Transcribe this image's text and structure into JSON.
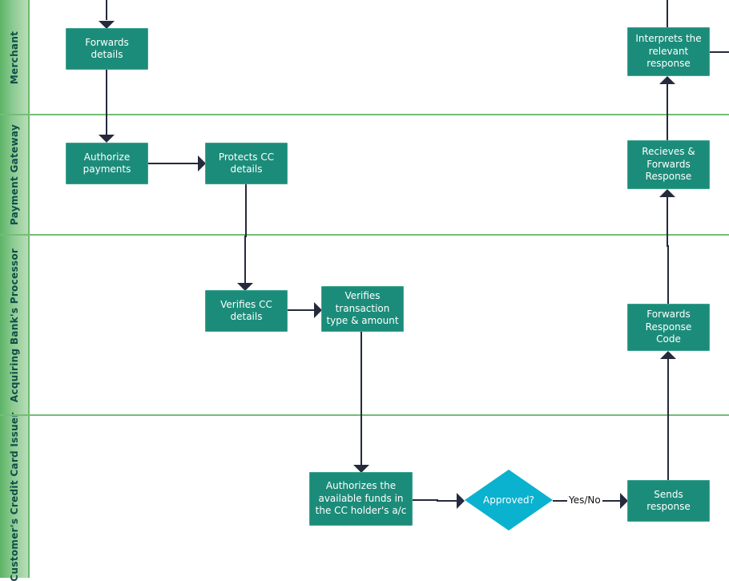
{
  "diagram": {
    "type": "swimlane-flowchart",
    "colors": {
      "process_fill": "#1c8c7a",
      "decision_fill": "#0ab2cf",
      "connector": "#252a3d",
      "lane_border": "#74bd76",
      "lane_label": "#0f4f46"
    },
    "lanes": [
      {
        "id": "merchant",
        "label": "Merchant"
      },
      {
        "id": "gateway",
        "label": "Payment Gateway"
      },
      {
        "id": "acquirer",
        "label": "Acquiring Bank's Processor"
      },
      {
        "id": "issuer",
        "label": "Customer's Credit Card Issuer"
      }
    ],
    "nodes": {
      "forwards_details": {
        "label": "Forwards\ndetails",
        "lane": "merchant",
        "shape": "process"
      },
      "authorize_payments": {
        "label": "Authorize\npayments",
        "lane": "gateway",
        "shape": "process"
      },
      "protects_cc": {
        "label": "Protects CC\ndetails",
        "lane": "gateway",
        "shape": "process"
      },
      "verifies_cc": {
        "label": "Verifies CC\ndetails",
        "lane": "acquirer",
        "shape": "process"
      },
      "verifies_txn": {
        "label": "Verifies\ntransaction\ntype & amount",
        "lane": "acquirer",
        "shape": "process"
      },
      "authorizes_funds": {
        "label": "Authorizes the\navailable funds in\nthe CC holder's a/c",
        "lane": "issuer",
        "shape": "process"
      },
      "approved": {
        "label": "Approved?",
        "lane": "issuer",
        "shape": "decision"
      },
      "sends_response": {
        "label": "Sends\nresponse",
        "lane": "issuer",
        "shape": "process"
      },
      "forwards_code": {
        "label": "Forwards\nResponse\nCode",
        "lane": "acquirer",
        "shape": "process"
      },
      "recieves_forwards": {
        "label": "Recieves &\nForwards\nResponse",
        "lane": "gateway",
        "shape": "process"
      },
      "interprets": {
        "label": "Interprets the\nrelevant\nresponse",
        "lane": "merchant",
        "shape": "process"
      }
    },
    "edges": [
      {
        "from": "(offscreen-top)",
        "to": "forwards_details"
      },
      {
        "from": "forwards_details",
        "to": "authorize_payments"
      },
      {
        "from": "authorize_payments",
        "to": "protects_cc"
      },
      {
        "from": "protects_cc",
        "to": "verifies_cc"
      },
      {
        "from": "verifies_cc",
        "to": "verifies_txn"
      },
      {
        "from": "verifies_txn",
        "to": "authorizes_funds"
      },
      {
        "from": "authorizes_funds",
        "to": "approved"
      },
      {
        "from": "approved",
        "to": "sends_response",
        "label": "Yes/No"
      },
      {
        "from": "sends_response",
        "to": "forwards_code"
      },
      {
        "from": "forwards_code",
        "to": "recieves_forwards"
      },
      {
        "from": "recieves_forwards",
        "to": "interprets"
      },
      {
        "from": "interprets",
        "to": "(offscreen-top)"
      },
      {
        "from": "interprets",
        "to": "(offscreen-right)"
      }
    ]
  }
}
